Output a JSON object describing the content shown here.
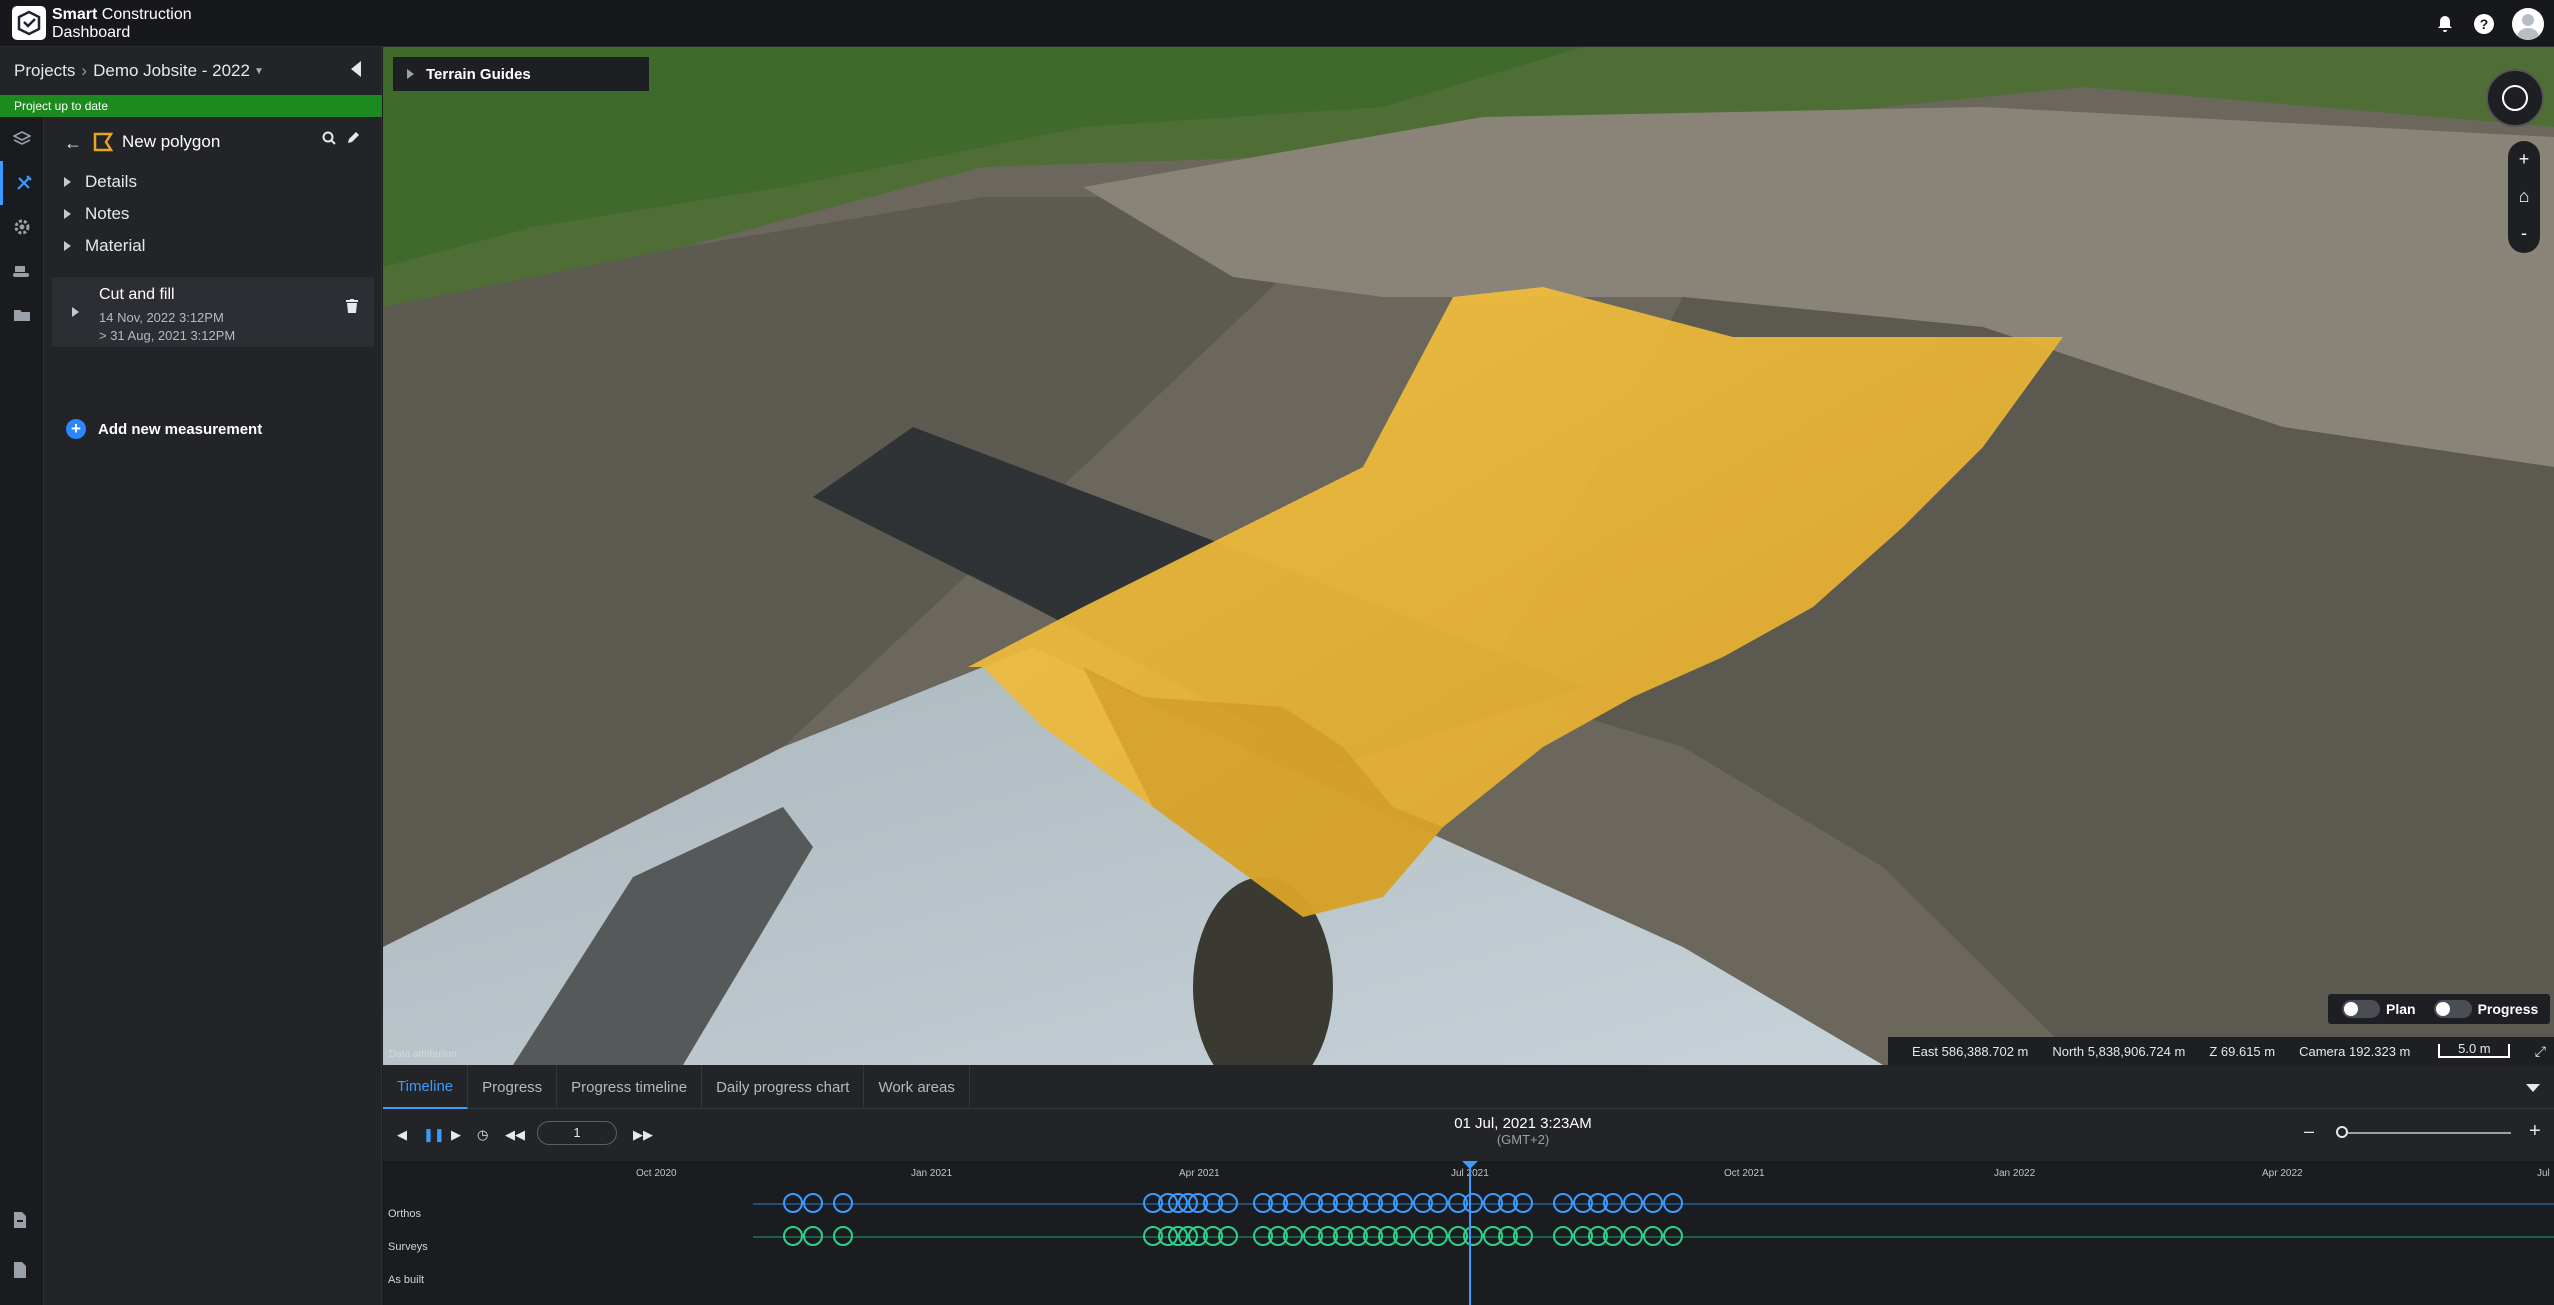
{
  "app": {
    "brand_bold": "Smart",
    "brand_rest": " Construction",
    "brand_line2": "Dashboard"
  },
  "breadcrumb": {
    "root": "Projects",
    "project": "Demo Jobsite - 2022"
  },
  "status": "Project up to date",
  "panel": {
    "title": "New polygon",
    "sections": [
      "Details",
      "Notes",
      "Material"
    ],
    "measurement": {
      "title": "Cut and fill",
      "date1": "14 Nov, 2022 3:12PM",
      "date2": "> 31 Aug, 2021 3:12PM"
    },
    "add_label": "Add new measurement"
  },
  "map": {
    "terrain_guides": "Terrain Guides",
    "toggles": {
      "plan": "Plan",
      "progress": "Progress"
    },
    "coords": {
      "east": "East 586,388.702 m",
      "north": "North 5,838,906.724 m",
      "z": "Z 69.615 m",
      "camera": "Camera 192.323 m",
      "scale": "5.0 m"
    },
    "attribution": "Data attribution"
  },
  "bottom": {
    "tabs": [
      "Timeline",
      "Progress",
      "Progress timeline",
      "Daily progress chart",
      "Work areas"
    ],
    "speed": "1",
    "date": "01 Jul, 2021 3:23AM",
    "timezone": "(GMT+2)",
    "ticks": [
      "Oct 2020",
      "Jan 2021",
      "Apr 2021",
      "Jul 2021",
      "Oct 2021",
      "Jan 2022",
      "Apr 2022",
      "Jul"
    ],
    "rows": [
      "Orthos",
      "Surveys",
      "As built"
    ]
  },
  "colors": {
    "accent": "#3b9bff",
    "status_green": "#1d8a1f",
    "polygon": "#f0b834",
    "ortho": "#3b9bff",
    "survey": "#2fd08a"
  }
}
